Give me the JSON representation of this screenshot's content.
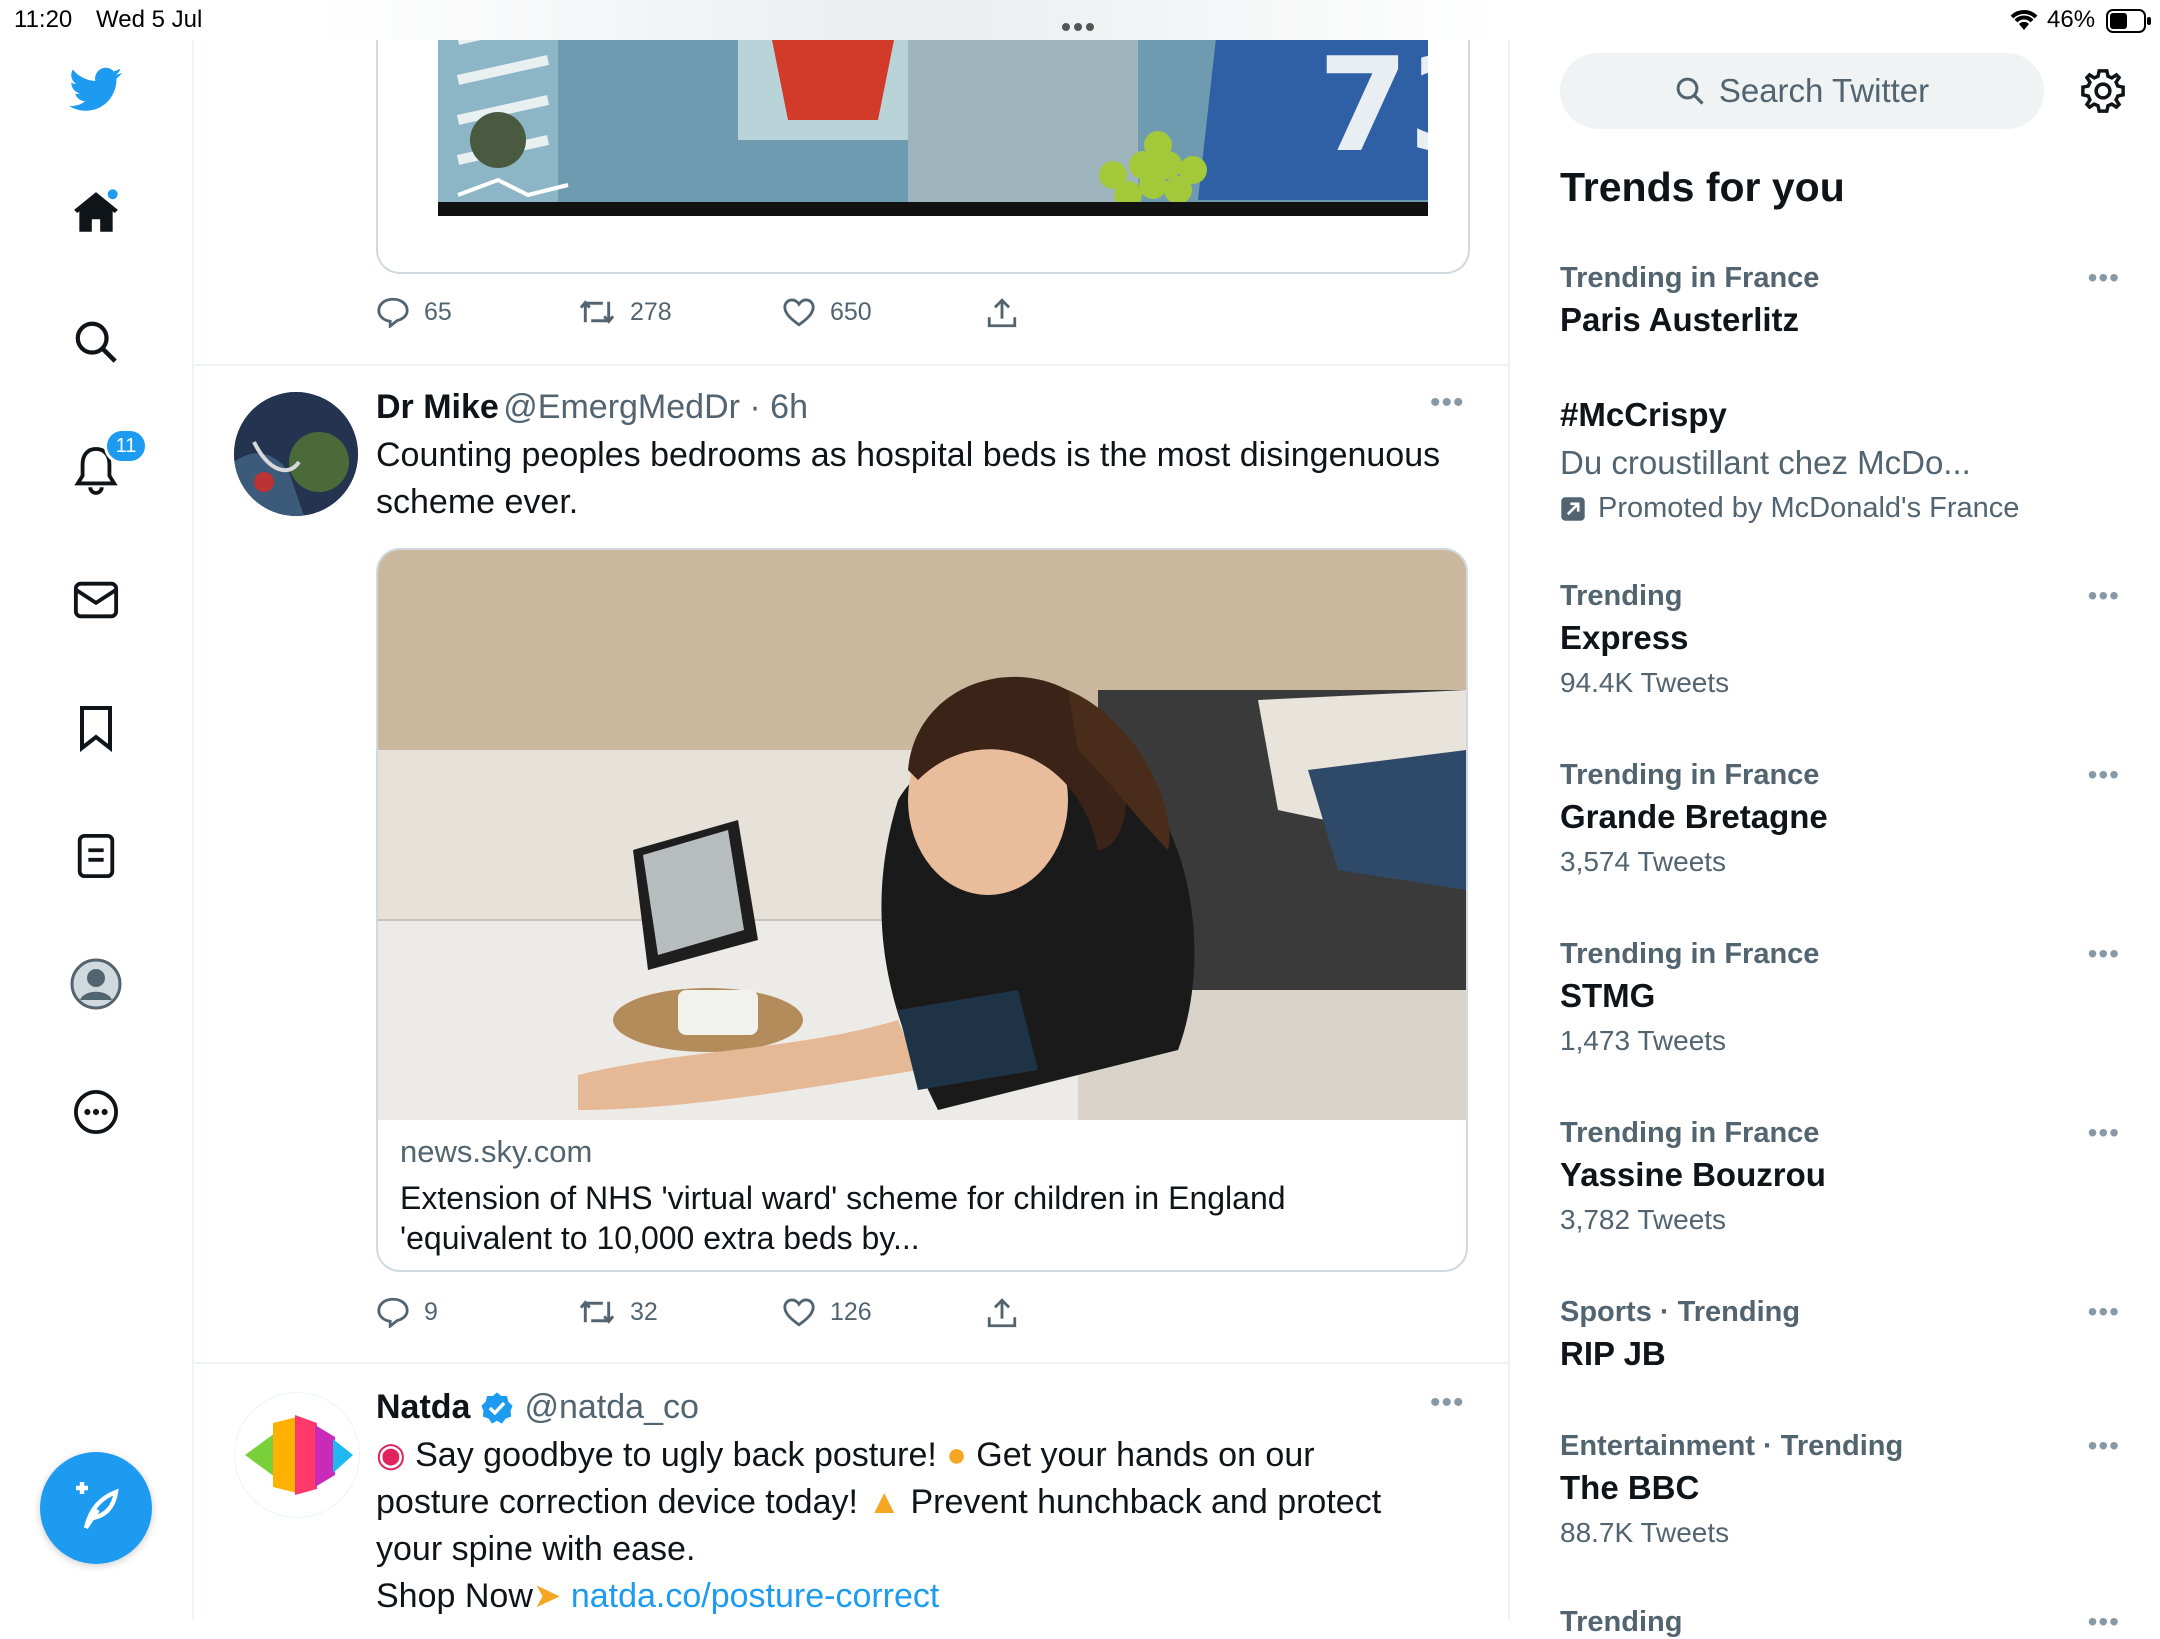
{
  "status_bar": {
    "time": "11:20",
    "date": "Wed 5 Jul",
    "battery": "46%"
  },
  "nav": {
    "notifications_badge": "11"
  },
  "timeline": {
    "tweet1_actions": {
      "replies": "65",
      "retweets": "278",
      "likes": "650"
    },
    "tweet2": {
      "name": "Dr Mike",
      "handle": "@EmergMedDr · 6h",
      "text": "Counting peoples bedrooms as hospital beds is the most disingenuous scheme ever.",
      "card_domain": "news.sky.com",
      "card_title": "Extension of NHS 'virtual ward' scheme for children in England 'equivalent to 10,000 extra beds by...",
      "replies": "9",
      "retweets": "32",
      "likes": "126"
    },
    "tweet3": {
      "name": "Natda",
      "handle": "@natda_co",
      "line1a": "Say goodbye to ugly back posture!",
      "line1b": "Get your hands on our",
      "line2a": "posture correction device today!",
      "line2b": "Prevent hunchback and protect",
      "line3": "your spine with ease.",
      "line4": "Shop Now",
      "link": "natda.co/posture-correct"
    }
  },
  "right": {
    "search_placeholder": "Search Twitter",
    "trends_title": "Trends for you",
    "trends": [
      {
        "context": "Trending in France",
        "name": "Paris Austerlitz",
        "count": ""
      },
      {
        "context": "#McCrispy",
        "name": "Du croustillant chez McDo...",
        "count": "Promoted by McDonald's France"
      },
      {
        "context": "Trending",
        "name": "Express",
        "count": "94.4K Tweets"
      },
      {
        "context": "Trending in France",
        "name": "Grande Bretagne",
        "count": "3,574 Tweets"
      },
      {
        "context": "Trending in France",
        "name": "STMG",
        "count": "1,473 Tweets"
      },
      {
        "context": "Trending in France",
        "name": "Yassine Bouzrou",
        "count": "3,782 Tweets"
      },
      {
        "context": "Sports · Trending",
        "name": "RIP JB",
        "count": ""
      },
      {
        "context": "Entertainment · Trending",
        "name": "The BBC",
        "count": "88.7K Tweets"
      },
      {
        "context": "Trending",
        "name": "",
        "count": ""
      }
    ]
  },
  "colors": {
    "accent": "#1d9bf0",
    "secondary_text": "#536471",
    "primary_text": "#0f1419"
  }
}
